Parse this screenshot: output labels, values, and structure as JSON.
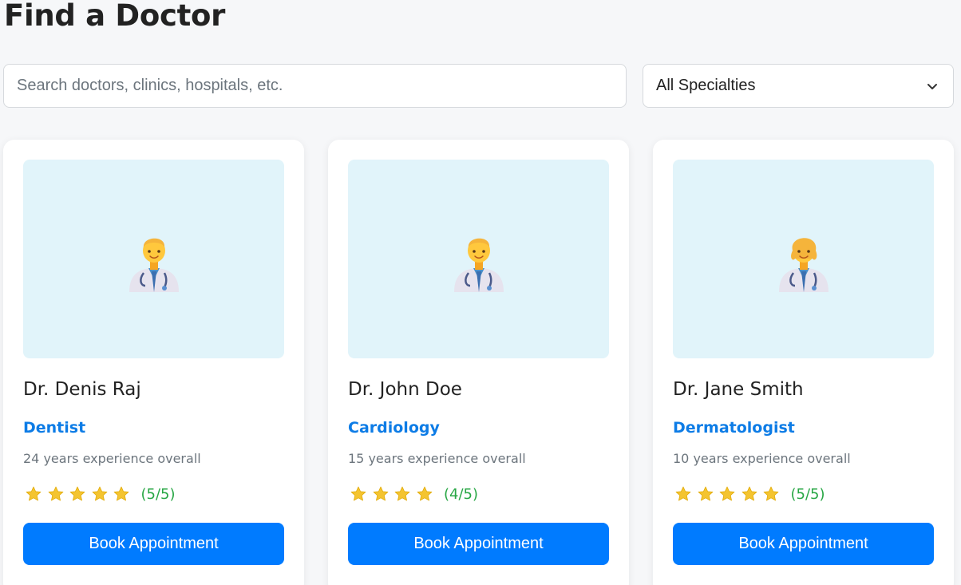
{
  "page": {
    "title": "Find a Doctor"
  },
  "search": {
    "placeholder": "Search doctors, clinics, hospitals, etc.",
    "value": ""
  },
  "filter": {
    "selected": "All Specialties"
  },
  "colors": {
    "accent": "#007bff",
    "specialty": "#0d7ce6",
    "rating": "#28a745",
    "photo_bg": "#e1f4fa",
    "star": "#f4c430"
  },
  "doctors": [
    {
      "name": "Dr. Denis Raj",
      "specialty": "Dentist",
      "experience": "24 years experience overall",
      "stars": 5,
      "rating_text": "(5/5)",
      "avatar_icon": "man-health-worker-icon",
      "button": "Book Appointment"
    },
    {
      "name": "Dr. John Doe",
      "specialty": "Cardiology",
      "experience": "15 years experience overall",
      "stars": 4,
      "rating_text": "(4/5)",
      "avatar_icon": "man-health-worker-icon",
      "button": "Book Appointment"
    },
    {
      "name": "Dr. Jane Smith",
      "specialty": "Dermatologist",
      "experience": "10 years experience overall",
      "stars": 5,
      "rating_text": "(5/5)",
      "avatar_icon": "woman-health-worker-icon",
      "button": "Book Appointment"
    }
  ]
}
